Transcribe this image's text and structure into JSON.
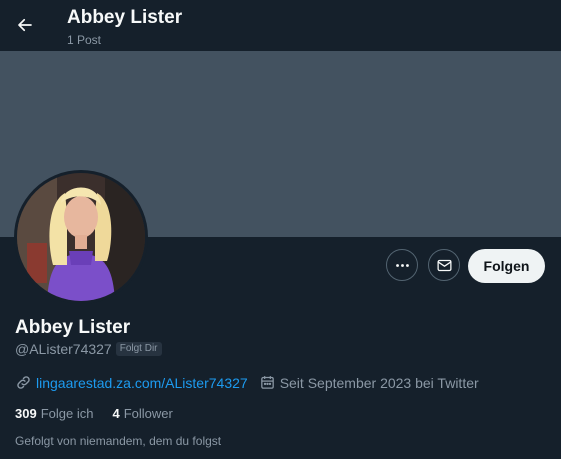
{
  "header": {
    "name": "Abbey Lister",
    "post_count": "1 Post"
  },
  "profile": {
    "display_name": "Abbey Lister",
    "handle": "@ALister74327",
    "follows_you_badge": "Folgt Dir",
    "website": "lingaarestad.za.com/ALister74327",
    "joined": "Seit September 2023 bei Twitter",
    "following_count": "309",
    "following_label": "Folge ich",
    "followers_count": "4",
    "followers_label": "Follower",
    "followed_by_text": "Gefolgt von niemandem, dem du folgst"
  },
  "actions": {
    "follow_label": "Folgen"
  },
  "icons": {
    "back": "arrow-left-icon",
    "more": "more-horizontal-icon",
    "message": "envelope-icon",
    "link": "link-icon",
    "calendar": "calendar-icon"
  },
  "colors": {
    "background": "#15202b",
    "banner": "#435260",
    "link": "#1d9bf0",
    "secondary_text": "#8b98a5",
    "follow_button": "#eff3f4"
  }
}
